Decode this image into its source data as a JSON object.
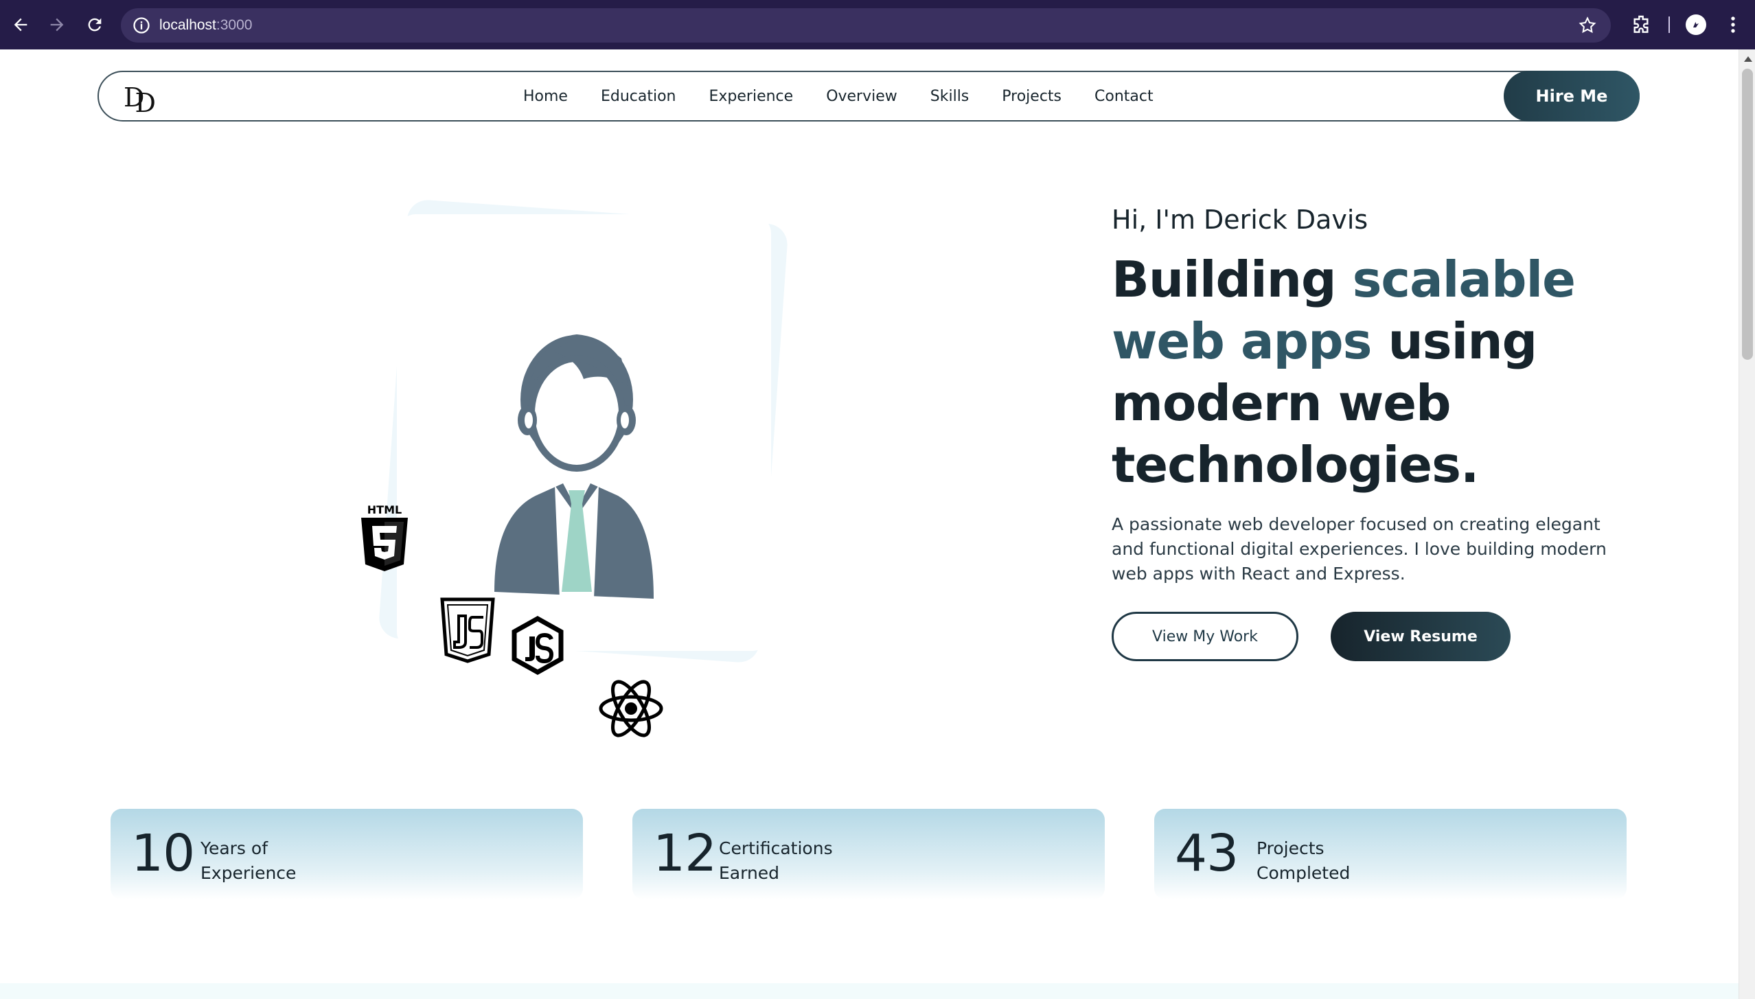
{
  "browser": {
    "url_host": "localhost",
    "url_port": ":3000"
  },
  "nav": {
    "logo": "DD",
    "links": [
      "Home",
      "Education",
      "Experience",
      "Overview",
      "Skills",
      "Projects",
      "Contact"
    ],
    "hire_label": "Hire Me"
  },
  "hero": {
    "greeting": "Hi, I'm Derick Davis",
    "headline_1": "Building ",
    "headline_accent_1": "scalable web apps",
    "headline_2": " using modern web technologies.",
    "description": "A passionate web developer focused on creating elegant and functional digital experiences. I love building modern web apps with React and Express.",
    "view_work_label": "View My Work",
    "view_resume_label": "View Resume",
    "html_badge": "HTML"
  },
  "stats": [
    {
      "number": "10",
      "line1": "Years of",
      "line2": "Experience"
    },
    {
      "number": "12",
      "line1": "Certifications",
      "line2": "Earned"
    },
    {
      "number": "43",
      "line1": "Projects",
      "line2": "Completed"
    }
  ],
  "colors": {
    "chrome_bg": "#251c48",
    "accent": "#2f5665",
    "dark": "#17242c",
    "stat_gradient_top": "#b4d8e6"
  }
}
